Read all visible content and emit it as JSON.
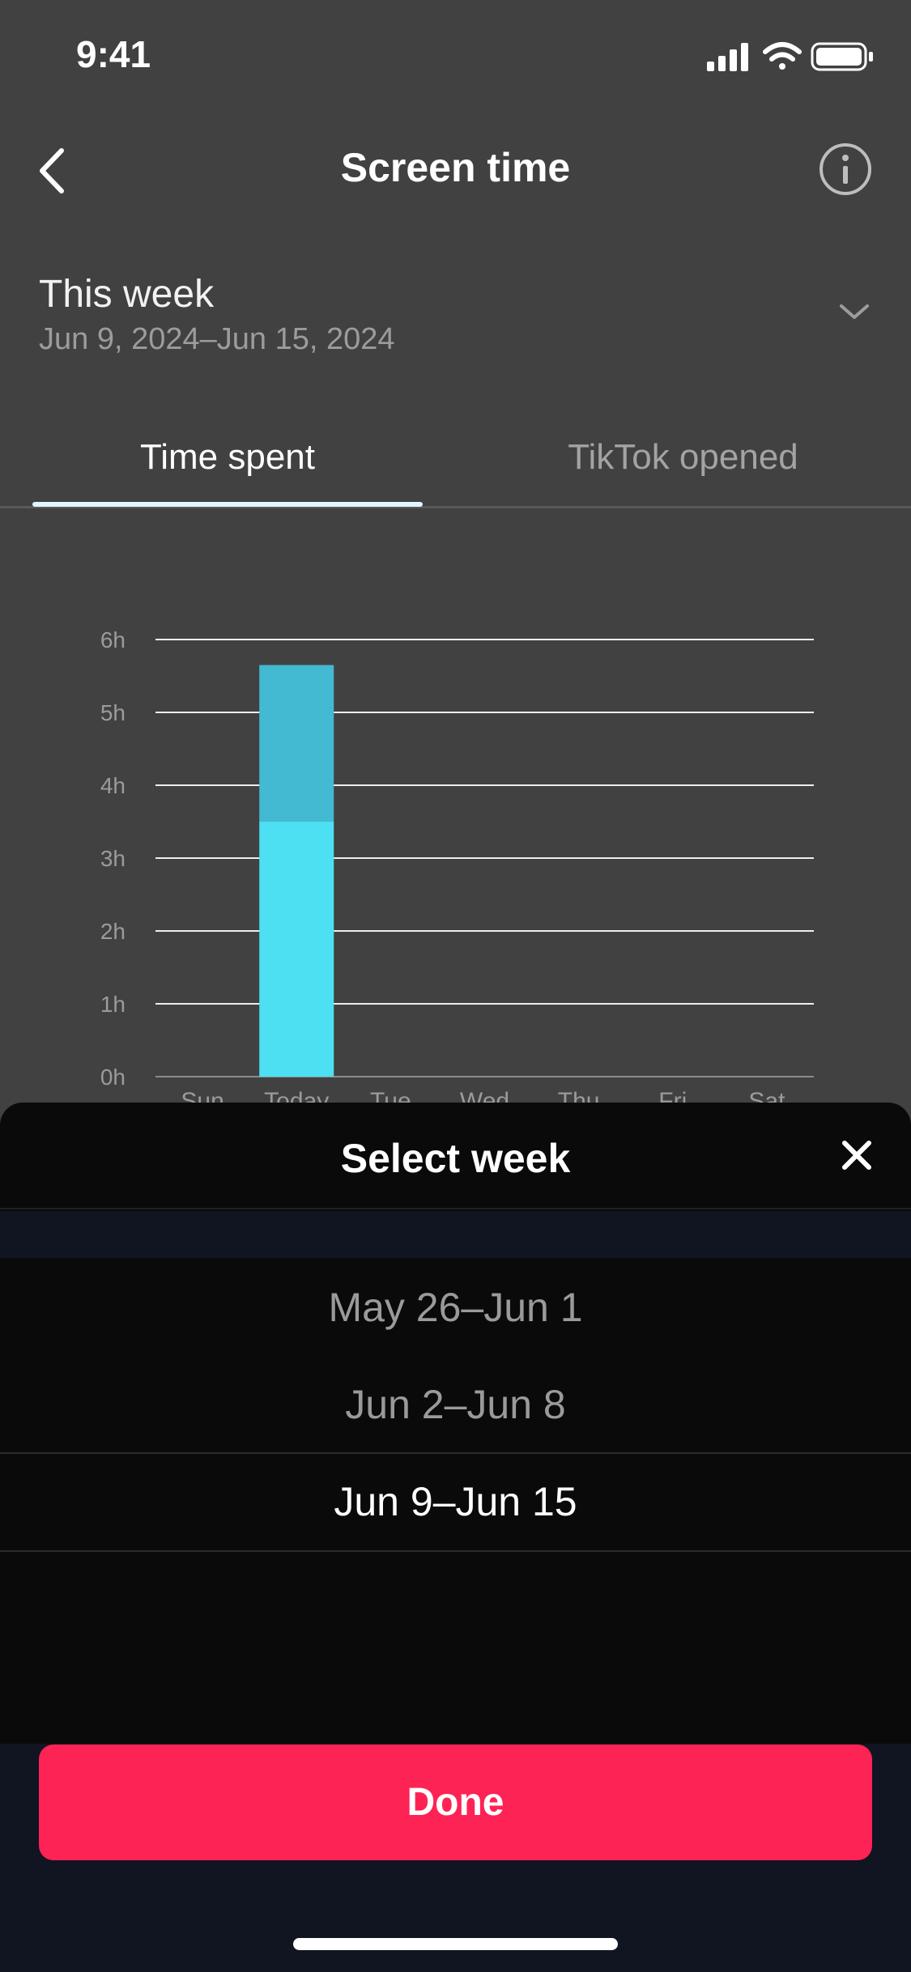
{
  "status_bar": {
    "time": "9:41",
    "icons": [
      "cellular-signal-icon",
      "wifi-icon",
      "battery-icon"
    ]
  },
  "nav": {
    "title": "Screen time",
    "back_icon": "chevron-left-icon",
    "info_icon": "info-icon"
  },
  "week_selector": {
    "title": "This week",
    "range": "Jun 9, 2024–Jun 15, 2024",
    "icon": "chevron-down-icon"
  },
  "tabs": [
    {
      "label": "Time spent",
      "active": true
    },
    {
      "label": "TikTok opened",
      "active": false
    }
  ],
  "chart_data": {
    "type": "bar",
    "categories": [
      "Sun",
      "Today",
      "Tue",
      "Wed",
      "Thu",
      "Fri",
      "Sat"
    ],
    "series": [
      {
        "values": [
          0,
          3.5,
          0,
          0,
          0,
          0,
          0
        ],
        "color": "#4ce0f2"
      },
      {
        "values": [
          0,
          2.15,
          0,
          0,
          0,
          0,
          0
        ],
        "color": "#43b9d2"
      }
    ],
    "y_ticks": [
      "0h",
      "1h",
      "2h",
      "3h",
      "4h",
      "5h",
      "6h"
    ],
    "ylim": [
      0,
      6
    ],
    "stacked": true,
    "grid": true
  },
  "sheet": {
    "title": "Select week",
    "close_icon": "close-icon",
    "options": [
      "May 26–Jun 1",
      "Jun 2–Jun 8",
      "Jun 9–Jun 15"
    ],
    "selected_index": 2,
    "done_label": "Done"
  },
  "colors": {
    "background": "#414141",
    "sheet": "#0a0a0a",
    "accent": "#fd2355",
    "bar_primary": "#4ce0f2",
    "bar_secondary": "#43b9d2"
  }
}
